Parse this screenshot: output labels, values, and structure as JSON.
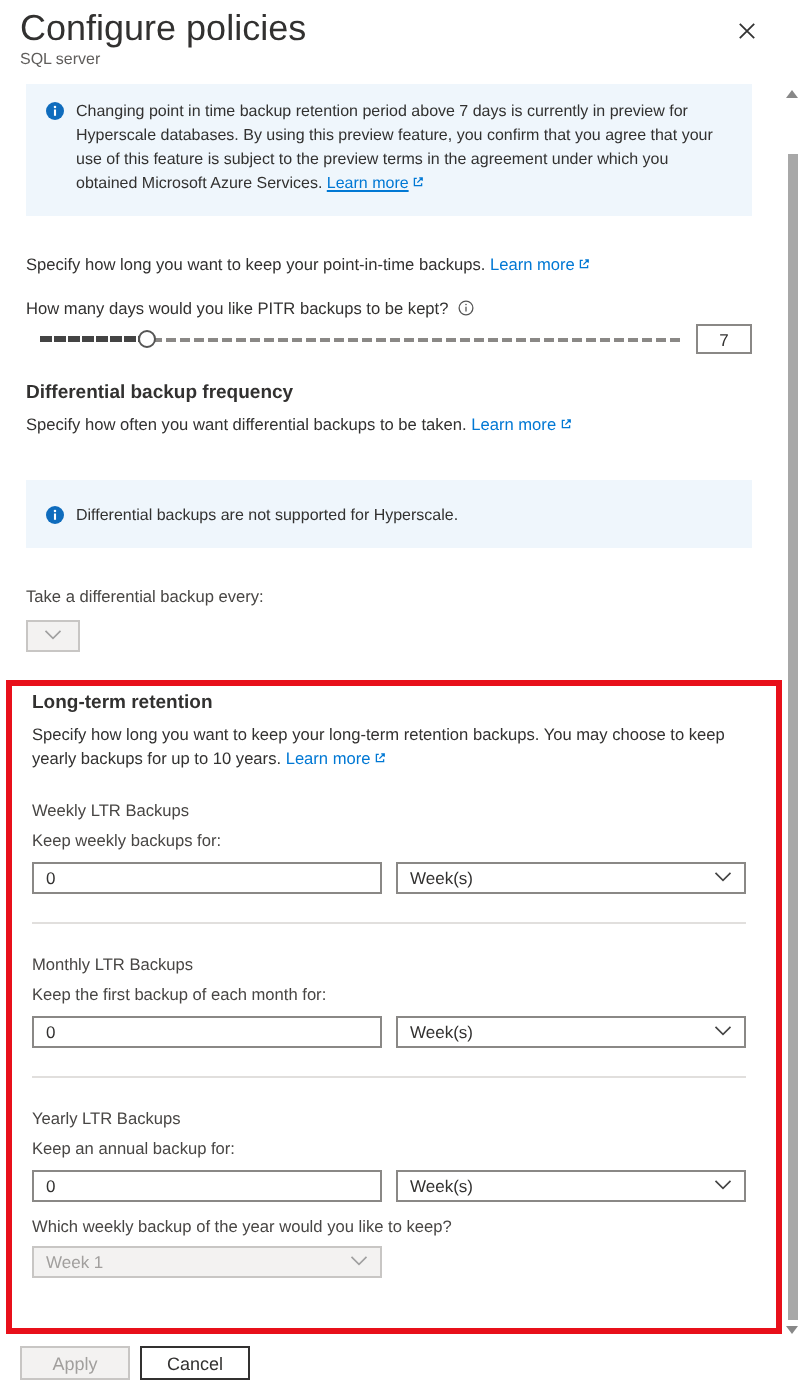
{
  "header": {
    "title": "Configure policies",
    "subtitle": "SQL server"
  },
  "preview_notice": {
    "text": "Changing point in time backup retention period above 7 days is currently in preview for Hyperscale databases. By using this preview feature, you confirm that you agree that your use of this feature is subject to the preview terms in the agreement under which you obtained Microsoft Azure Services.",
    "link": "Learn more"
  },
  "pitr": {
    "description": "Specify how long you want to keep your point-in-time backups.",
    "link": "Learn more",
    "question": "How many days would you like PITR backups to be kept?",
    "slider": {
      "level": 0.17
    },
    "value": "7"
  },
  "differential": {
    "heading": "Differential backup frequency",
    "description": "Specify how often you want differential backups to be taken.",
    "link": "Learn more",
    "notice": "Differential backups are not supported for Hyperscale.",
    "label": "Take a differential backup every:",
    "dropdown": {
      "disabled": true
    }
  },
  "ltr": {
    "highlighted": true,
    "heading": "Long-term retention",
    "description": "Specify how long you want to keep your long-term retention backups. You may choose to keep yearly backups for up to 10 years.",
    "link": "Learn more",
    "groups": [
      {
        "title": "Weekly LTR Backups",
        "label": "Keep weekly backups for:",
        "value": "0",
        "unit": "Week(s)"
      },
      {
        "title": "Monthly LTR Backups",
        "label": "Keep the first backup of each month for:",
        "value": "0",
        "unit": "Week(s)"
      },
      {
        "title": "Yearly LTR Backups",
        "label": "Keep an annual backup for:",
        "value": "0",
        "unit": "Week(s)"
      }
    ],
    "week_question": "Which weekly backup of the year would you like to keep?",
    "week_dropdown": {
      "value": "Week 1",
      "disabled": true
    }
  },
  "buttons": [
    {
      "label": "Apply",
      "disabled": true
    },
    {
      "label": "Cancel",
      "disabled": false
    }
  ]
}
